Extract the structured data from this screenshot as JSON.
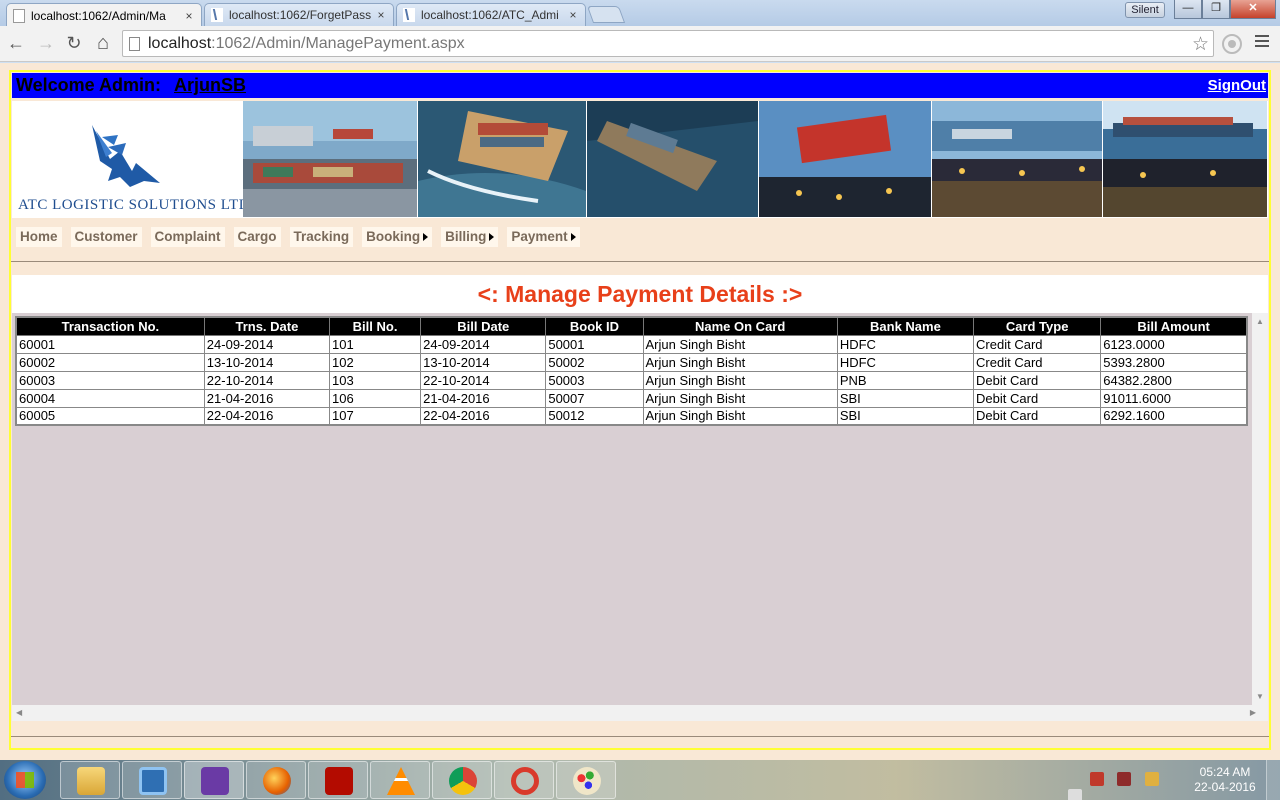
{
  "browser": {
    "tabs": [
      {
        "title": "localhost:1062/Admin/Ma",
        "active": true
      },
      {
        "title": "localhost:1062/ForgetPass",
        "active": false
      },
      {
        "title": "localhost:1062/ATC_Admi",
        "active": false
      }
    ],
    "close_glyph": "×",
    "badge": "Silent",
    "window_buttons": {
      "minimize": "—",
      "maximize": "❐",
      "close": "✕"
    },
    "nav": {
      "back": "←",
      "forward": "→",
      "reload": "↻",
      "home": "⌂"
    },
    "url_host": "localhost",
    "url_path": ":1062/Admin/ManagePayment.aspx",
    "bookmark_glyph": "☆"
  },
  "header": {
    "welcome": "Welcome Admin:",
    "username": "ArjunSB",
    "signout": "SignOut",
    "logo_text": "ATC LOGISTIC SOLUTIONS LTD.,",
    "logo_icon": "eagle-icon"
  },
  "menu": [
    {
      "label": "Home",
      "submenu": false
    },
    {
      "label": "Customer",
      "submenu": false
    },
    {
      "label": "Complaint",
      "submenu": false
    },
    {
      "label": "Cargo",
      "submenu": false
    },
    {
      "label": "Tracking",
      "submenu": false
    },
    {
      "label": "Booking",
      "submenu": true
    },
    {
      "label": "Billing",
      "submenu": true
    },
    {
      "label": "Payment",
      "submenu": true
    }
  ],
  "page": {
    "heading": "<: Manage Payment Details :>"
  },
  "table": {
    "columns": [
      "Transaction No.",
      "Trns. Date",
      "Bill No.",
      "Bill Date",
      "Book ID",
      "Name On Card",
      "Bank Name",
      "Card Type",
      "Bill Amount"
    ],
    "rows": [
      [
        "60001",
        "24-09-2014",
        "101",
        "24-09-2014",
        "50001",
        "Arjun Singh Bisht",
        "HDFC",
        "Credit Card",
        "6123.0000"
      ],
      [
        "60002",
        "13-10-2014",
        "102",
        "13-10-2014",
        "50002",
        "Arjun Singh Bisht",
        "HDFC",
        "Credit Card",
        "5393.2800"
      ],
      [
        "60003",
        "22-10-2014",
        "103",
        "22-10-2014",
        "50003",
        "Arjun Singh Bisht",
        "PNB",
        "Debit Card",
        "64382.2800"
      ],
      [
        "60004",
        "21-04-2016",
        "106",
        "21-04-2016",
        "50007",
        "Arjun Singh Bisht",
        "SBI",
        "Debit Card",
        "91011.6000"
      ],
      [
        "60005",
        "22-04-2016",
        "107",
        "22-04-2016",
        "50012",
        "Arjun Singh Bisht",
        "SBI",
        "Debit Card",
        "6292.1600"
      ]
    ]
  },
  "taskbar": {
    "time": "05:24 AM",
    "date": "22-04-2016",
    "apps": [
      "file-explorer-icon",
      "media-player-icon",
      "visual-studio-icon",
      "firefox-icon",
      "acrobat-icon",
      "vlc-icon",
      "chrome-icon",
      "ccleaner-icon",
      "paint-icon"
    ]
  },
  "colors": {
    "welcome_bar": "#0000ff",
    "heading": "#e8401a",
    "page_bg": "#f9e8d6",
    "frame_border": "#ffff33"
  }
}
